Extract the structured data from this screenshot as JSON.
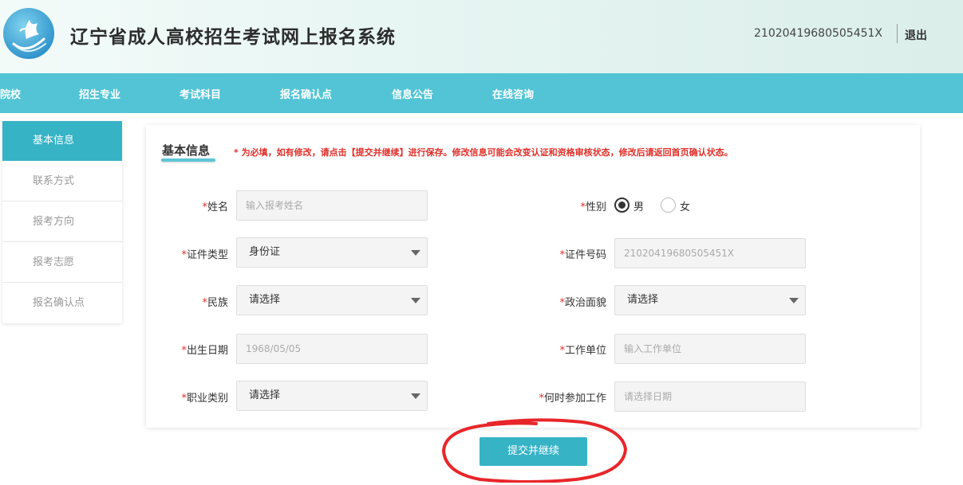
{
  "header": {
    "title": "辽宁省成人高校招生考试网上报名系统",
    "user_id": "21020419680505451X",
    "logout_label": "退出"
  },
  "nav": {
    "items": [
      "院校",
      "招生专业",
      "考试科目",
      "报名确认点",
      "信息公告",
      "在线咨询"
    ]
  },
  "sidebar": {
    "items": [
      {
        "label": "基本信息",
        "active": true
      },
      {
        "label": "联系方式"
      },
      {
        "label": "报考方向"
      },
      {
        "label": "报考志愿"
      },
      {
        "label": "报名确认点"
      }
    ]
  },
  "form": {
    "section_title": "基本信息",
    "notice": "* 为必填，如有修改，请点击【提交并继续】进行保存。修改信息可能会改变认证和资格审核状态，修改后请返回首页确认状态。",
    "required_mark": "*",
    "name": {
      "label": "姓名",
      "placeholder": "输入报考姓名"
    },
    "gender": {
      "label": "性别",
      "options": [
        "男",
        "女"
      ],
      "selected": "男"
    },
    "id_type": {
      "label": "证件类型",
      "value": "身份证"
    },
    "id_number": {
      "label": "证件号码",
      "value": "21020419680505451X"
    },
    "ethnicity": {
      "label": "民族",
      "value": "请选择"
    },
    "political": {
      "label": "政治面貌",
      "value": "请选择"
    },
    "birth_date": {
      "label": "出生日期",
      "value": "1968/05/05"
    },
    "workplace": {
      "label": "工作单位",
      "placeholder": "输入工作单位"
    },
    "occupation": {
      "label": "职业类别",
      "value": "请选择"
    },
    "work_start": {
      "label": "何时参加工作",
      "placeholder": "请选择日期"
    }
  },
  "submit_label": "提交并继续",
  "colors": {
    "accent": "#52c4d6",
    "active": "#37b3c6",
    "required": "#e0302a",
    "annotation": "#e8262a"
  }
}
